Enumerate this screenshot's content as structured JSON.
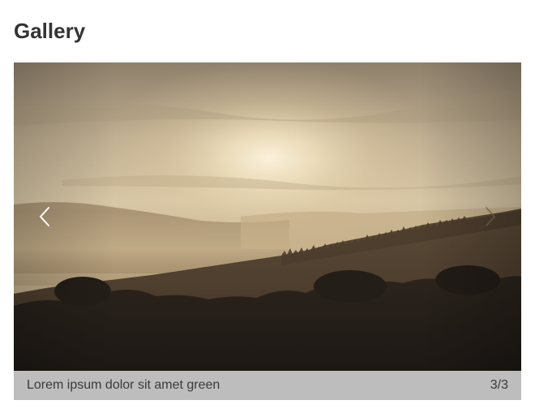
{
  "page": {
    "title": "Gallery"
  },
  "gallery": {
    "image_alt": "Misty sunrise over forested hills",
    "caption": "Lorem ipsum dolor sit amet green",
    "counter": "3/3",
    "current_index": 3,
    "total": 3,
    "prev_icon": "chevron-left-icon",
    "next_icon": "chevron-right-icon"
  },
  "colors": {
    "caption_bar": "#bdbdbd",
    "caption_text": "#3a3a3a",
    "title_text": "#333333"
  }
}
